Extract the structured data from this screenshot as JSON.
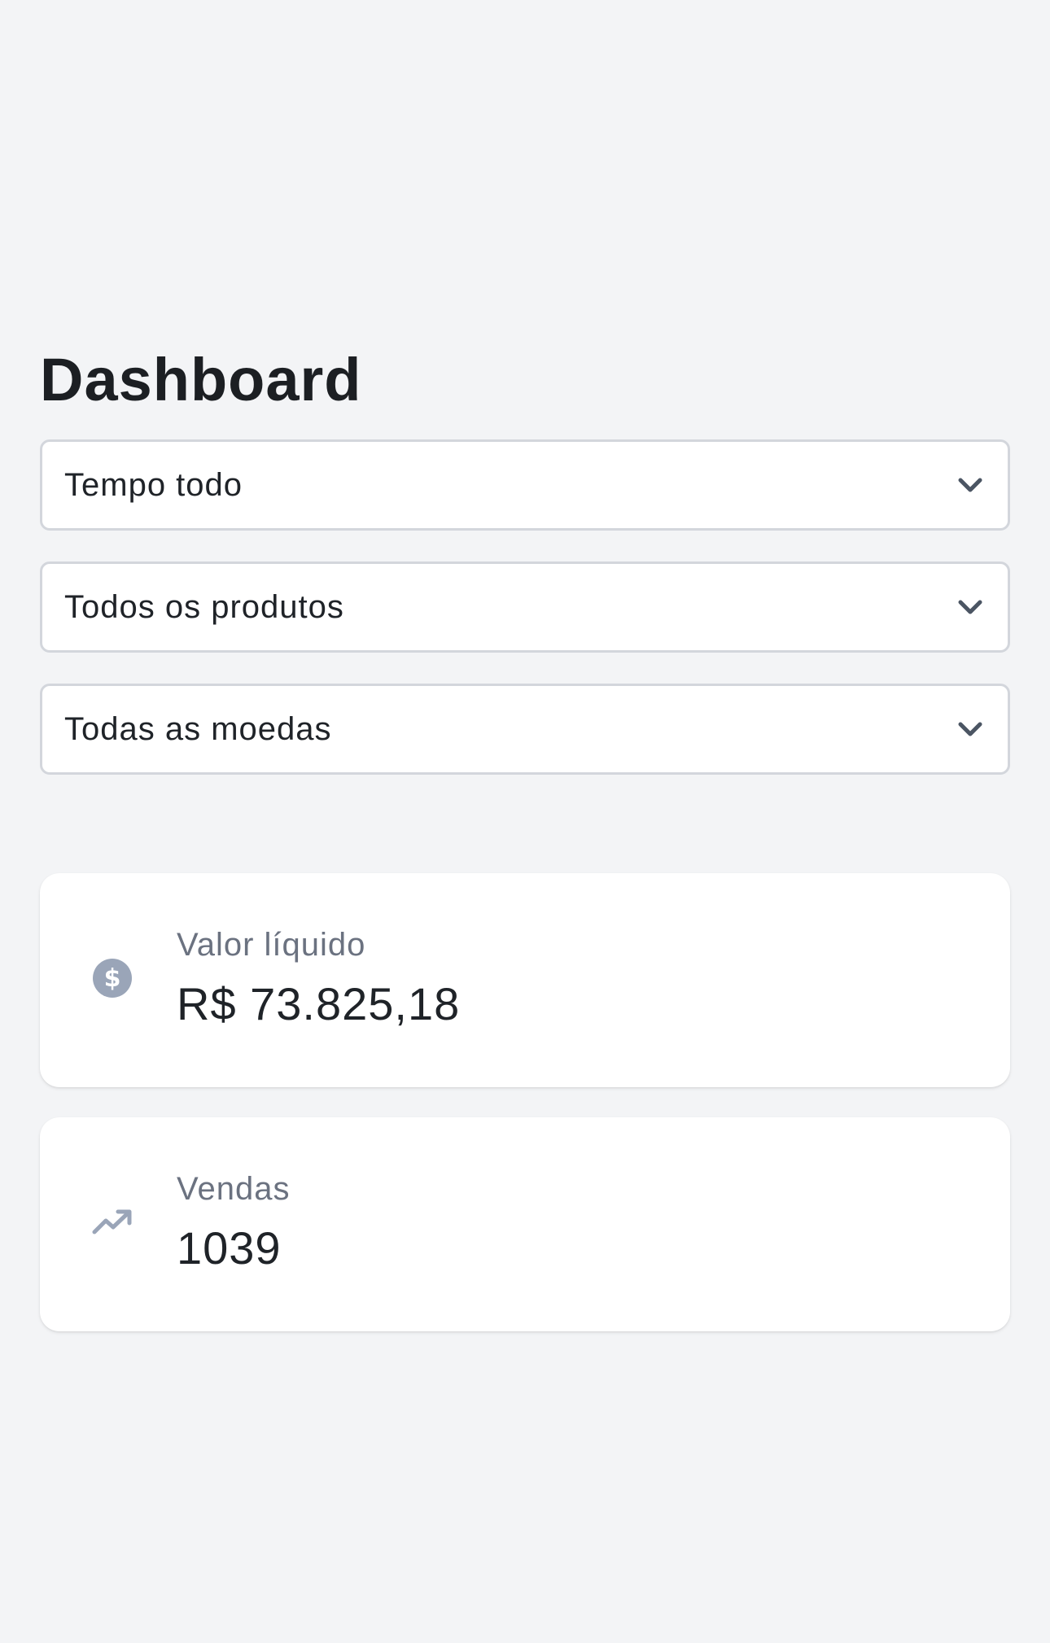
{
  "page": {
    "title": "Dashboard"
  },
  "filters": {
    "period": {
      "value": "Tempo todo",
      "icon": "chevron-down-icon"
    },
    "product": {
      "value": "Todos os produtos",
      "icon": "chevron-down-icon"
    },
    "currency": {
      "value": "Todas as moedas",
      "icon": "chevron-down-icon"
    }
  },
  "stats": {
    "net_value": {
      "label": "Valor líquido",
      "value": "R$ 73.825,18",
      "icon": "dollar-circle-icon"
    },
    "sales": {
      "label": "Vendas",
      "value": "1039",
      "icon": "trending-up-icon"
    }
  },
  "colors": {
    "background": "#f3f4f6",
    "card": "#ffffff",
    "icon": "#9aa5b8",
    "muted_text": "#6b7280"
  }
}
